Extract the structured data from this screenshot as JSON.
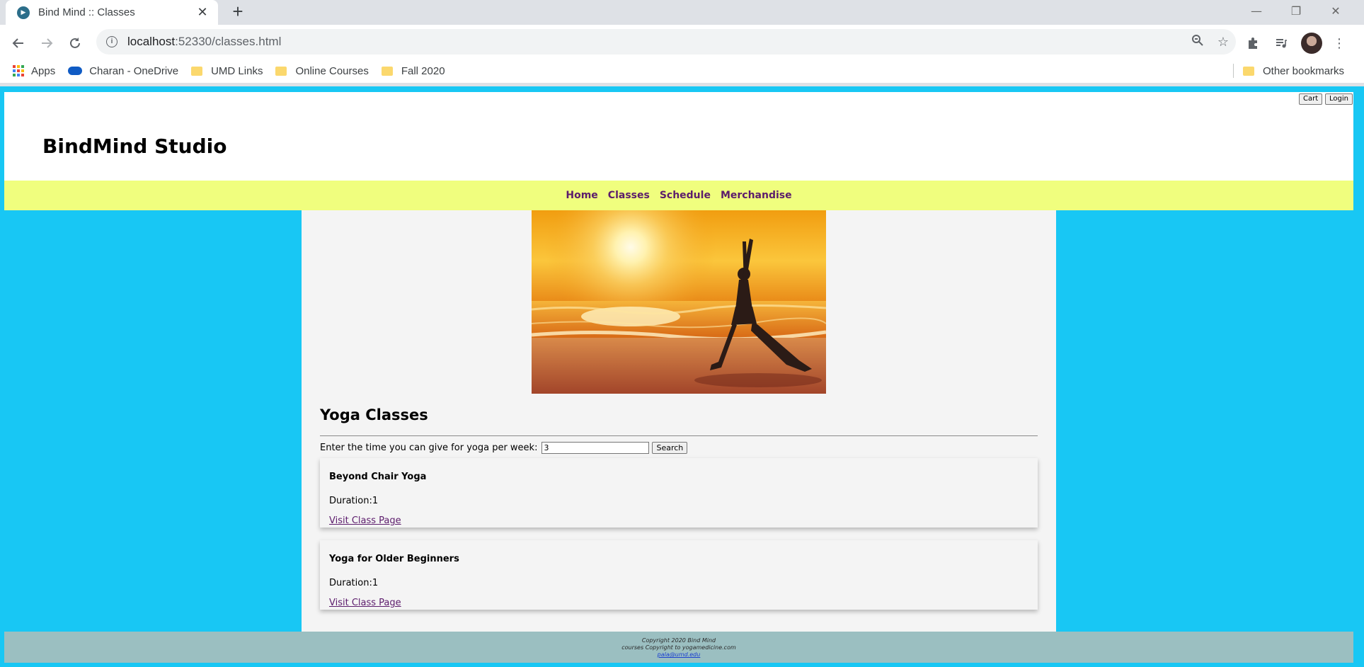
{
  "browser": {
    "tab_title": "Bind Mind :: Classes",
    "url_host": "localhost",
    "url_rest": ":52330/classes.html",
    "bookmarks": [
      "Apps",
      "Charan - OneDrive",
      "UMD Links",
      "Online Courses",
      "Fall 2020"
    ],
    "other_bookmarks": "Other bookmarks"
  },
  "site": {
    "title": "BindMind Studio",
    "cart_label": "Cart",
    "login_label": "Login",
    "nav": [
      "Home",
      "Classes",
      "Schedule",
      "Merchandise"
    ]
  },
  "main": {
    "heading": "Yoga Classes",
    "search_prompt": "Enter the time you can give for yoga per week:",
    "search_value": "3",
    "search_button": "Search",
    "classes": [
      {
        "name": "Beyond Chair Yoga",
        "duration": "Duration:1",
        "link": "Visit Class Page"
      },
      {
        "name": "Yoga for Older Beginners",
        "duration": "Duration:1",
        "link": "Visit Class Page"
      }
    ]
  },
  "footer": {
    "line1": "Copyright 2020 Bind Mind",
    "line2": "courses Copyright to yogamedicine.com",
    "email": "pala@umd.edu"
  },
  "colors": {
    "page_background": "#18c7f4",
    "nav_background": "#f0fe7e",
    "nav_link": "#5c1c6c",
    "footer_background": "#9bbfc1",
    "content_background": "#f4f4f4"
  }
}
